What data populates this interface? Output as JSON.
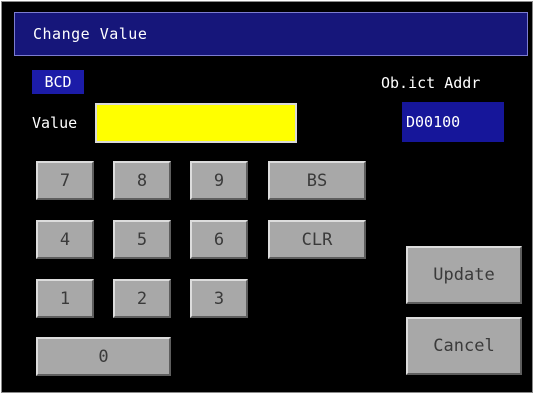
{
  "window": {
    "title": "Change Value"
  },
  "mode_label": "BCD",
  "value": {
    "label": "Value",
    "current": ""
  },
  "object_addr": {
    "label": "Ob.ict Addr",
    "value": "D00100"
  },
  "keypad": {
    "k7": "7",
    "k8": "8",
    "k9": "9",
    "bs": "BS",
    "k4": "4",
    "k5": "5",
    "k6": "6",
    "clr": "CLR",
    "k1": "1",
    "k2": "2",
    "k3": "3",
    "k0": "0"
  },
  "actions": {
    "update": "Update",
    "cancel": "Cancel"
  },
  "colors": {
    "title_bar": "#16167a",
    "value_field": "#ffff00",
    "addr_field": "#16169a",
    "button_face": "#a8a8a8",
    "background": "#000000"
  }
}
